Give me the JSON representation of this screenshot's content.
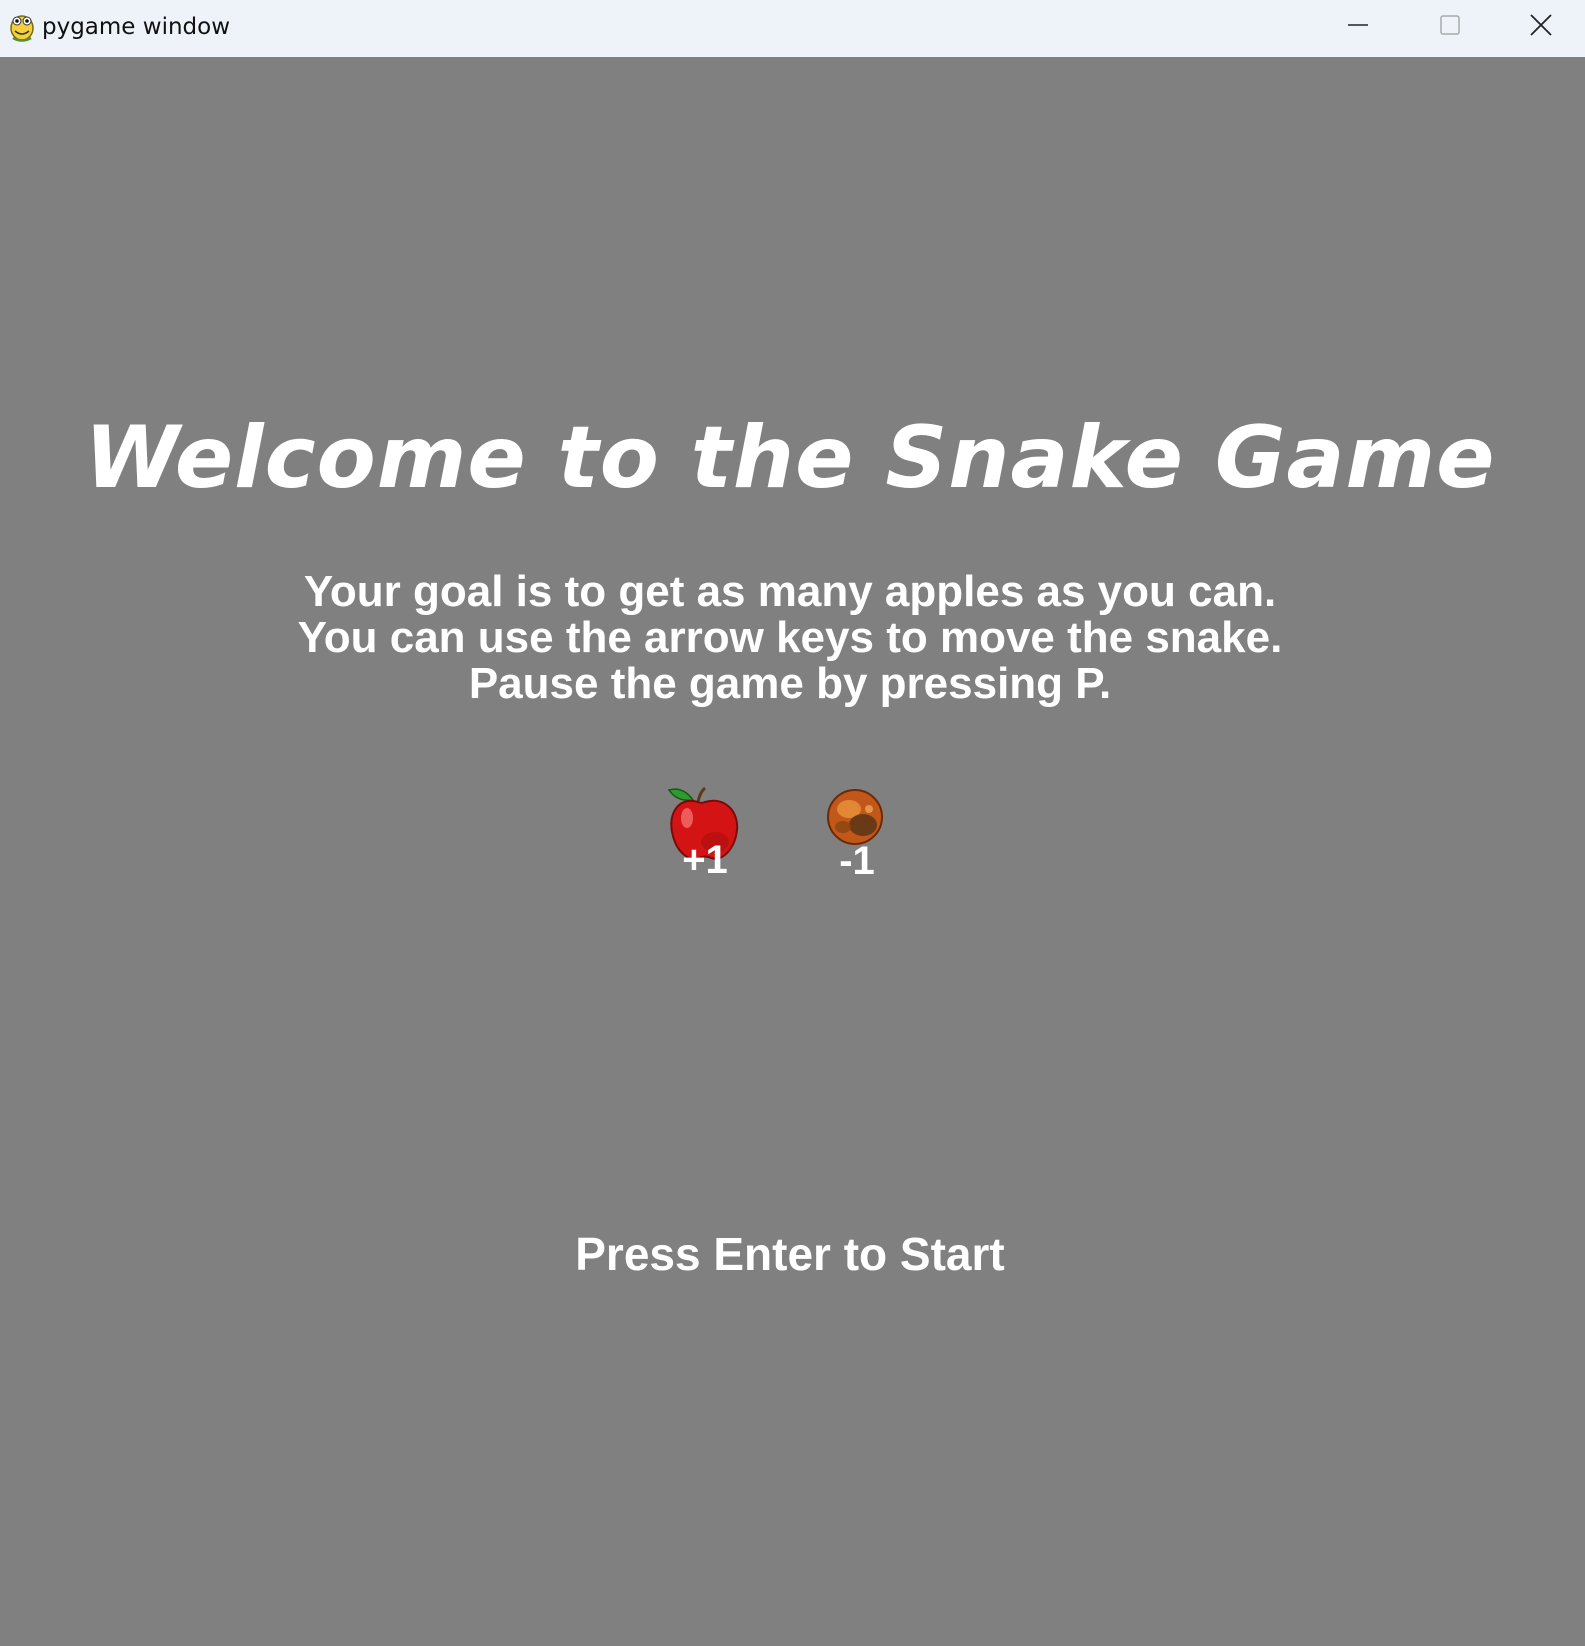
{
  "window": {
    "title": "pygame window",
    "icon": "pygame-snake-icon",
    "controls": {
      "minimize_icon": "minimize-icon",
      "maximize_icon": "maximize-icon",
      "close_icon": "close-icon"
    }
  },
  "game": {
    "background_color": "#808080",
    "title": "Welcome to the Snake Game",
    "instructions": [
      "Your goal is to get as many apples as you can.",
      "You can use the arrow keys to move the snake.",
      "Pause the game by pressing P."
    ],
    "items": [
      {
        "icon": "red-apple-icon",
        "points": "+1"
      },
      {
        "icon": "rotten-apple-icon",
        "points": "-1"
      }
    ],
    "start_prompt": "Press Enter to Start"
  }
}
